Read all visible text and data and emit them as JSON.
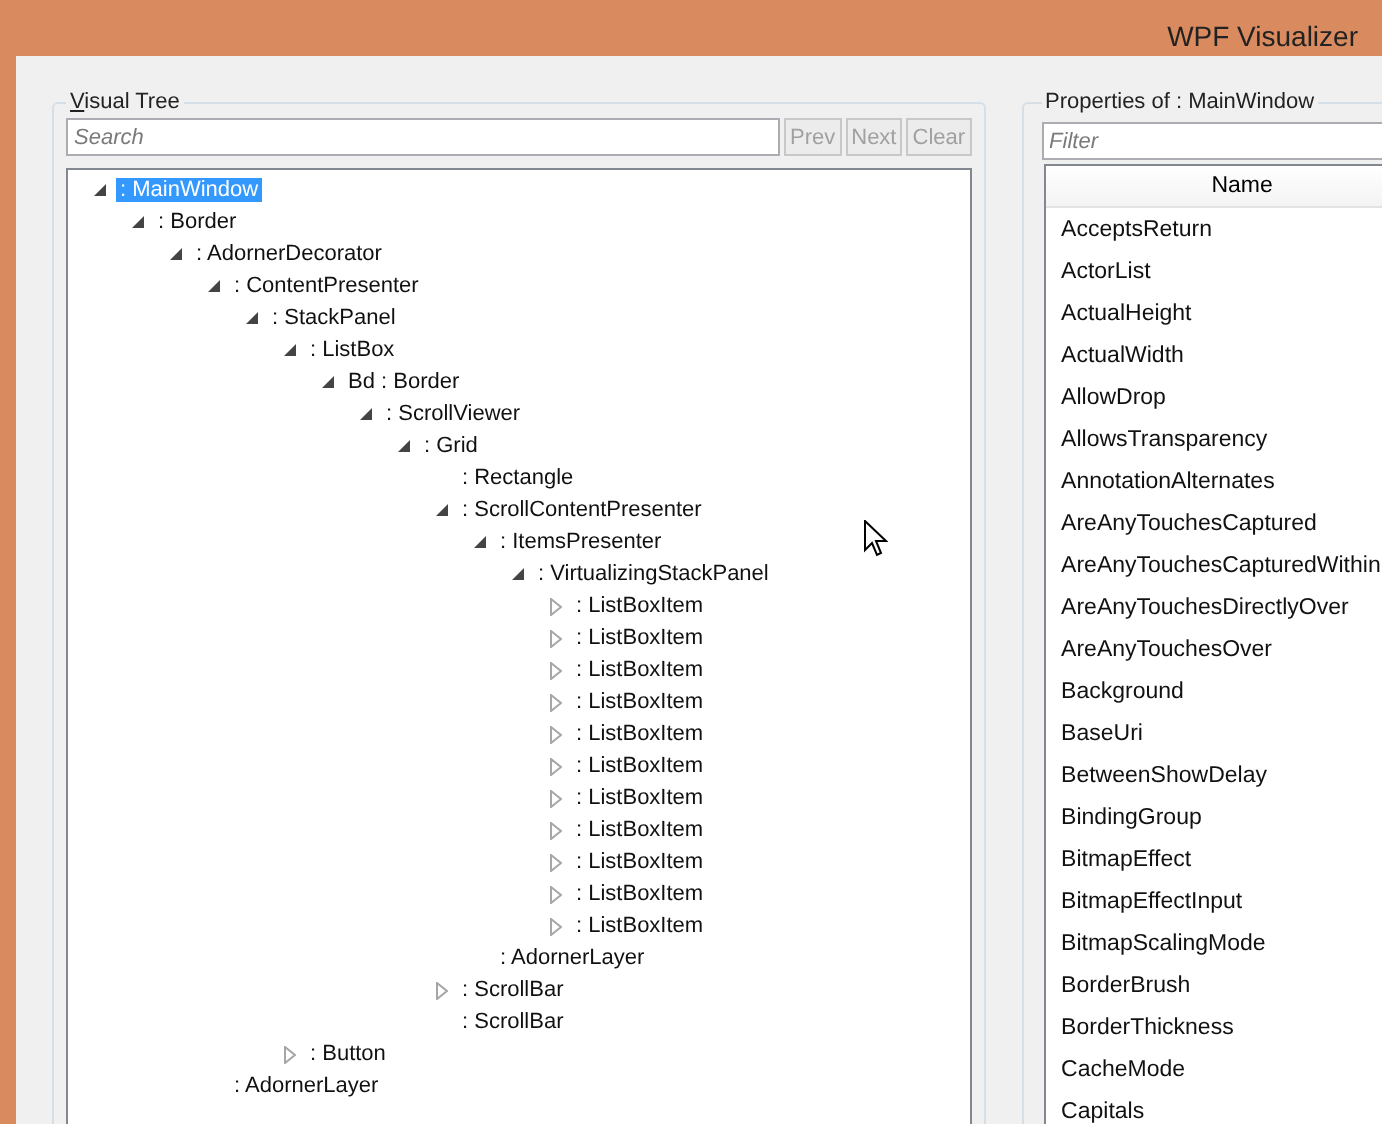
{
  "window": {
    "title": "WPF Visualizer"
  },
  "visual_tree": {
    "title": "Visual Tree",
    "search": {
      "placeholder": "Search"
    },
    "buttons": [
      {
        "label": "Prev",
        "disabled": true
      },
      {
        "label": "Next",
        "disabled": true
      },
      {
        "label": "Clear",
        "disabled": true
      }
    ],
    "nodes": [
      {
        "label": ": MainWindow",
        "expandable": true,
        "expanded": true,
        "selected": true,
        "children": [
          {
            "label": ": Border",
            "expandable": true,
            "expanded": true,
            "selected": false,
            "children": [
              {
                "label": ": AdornerDecorator",
                "expandable": true,
                "expanded": true,
                "selected": false,
                "children": [
                  {
                    "label": ": ContentPresenter",
                    "expandable": true,
                    "expanded": true,
                    "selected": false,
                    "children": [
                      {
                        "label": ": StackPanel",
                        "expandable": true,
                        "expanded": true,
                        "selected": false,
                        "children": [
                          {
                            "label": ": ListBox",
                            "expandable": true,
                            "expanded": true,
                            "selected": false,
                            "children": [
                              {
                                "label": "Bd : Border",
                                "expandable": true,
                                "expanded": true,
                                "selected": false,
                                "children": [
                                  {
                                    "label": ": ScrollViewer",
                                    "expandable": true,
                                    "expanded": true,
                                    "selected": false,
                                    "children": [
                                      {
                                        "label": ": Grid",
                                        "expandable": true,
                                        "expanded": true,
                                        "selected": false,
                                        "children": [
                                          {
                                            "label": ": Rectangle",
                                            "expandable": false,
                                            "selected": false
                                          },
                                          {
                                            "label": ": ScrollContentPresenter",
                                            "expandable": true,
                                            "expanded": true,
                                            "selected": false,
                                            "children": [
                                              {
                                                "label": ": ItemsPresenter",
                                                "expandable": true,
                                                "expanded": true,
                                                "selected": false,
                                                "children": [
                                                  {
                                                    "label": ": VirtualizingStackPanel",
                                                    "expandable": true,
                                                    "expanded": true,
                                                    "selected": false,
                                                    "children": [
                                                      {
                                                        "label": ": ListBoxItem",
                                                        "expandable": true,
                                                        "expanded": false,
                                                        "selected": false
                                                      },
                                                      {
                                                        "label": ": ListBoxItem",
                                                        "expandable": true,
                                                        "expanded": false,
                                                        "selected": false
                                                      },
                                                      {
                                                        "label": ": ListBoxItem",
                                                        "expandable": true,
                                                        "expanded": false,
                                                        "selected": false
                                                      },
                                                      {
                                                        "label": ": ListBoxItem",
                                                        "expandable": true,
                                                        "expanded": false,
                                                        "selected": false
                                                      },
                                                      {
                                                        "label": ": ListBoxItem",
                                                        "expandable": true,
                                                        "expanded": false,
                                                        "selected": false
                                                      },
                                                      {
                                                        "label": ": ListBoxItem",
                                                        "expandable": true,
                                                        "expanded": false,
                                                        "selected": false
                                                      },
                                                      {
                                                        "label": ": ListBoxItem",
                                                        "expandable": true,
                                                        "expanded": false,
                                                        "selected": false
                                                      },
                                                      {
                                                        "label": ": ListBoxItem",
                                                        "expandable": true,
                                                        "expanded": false,
                                                        "selected": false
                                                      },
                                                      {
                                                        "label": ": ListBoxItem",
                                                        "expandable": true,
                                                        "expanded": false,
                                                        "selected": false
                                                      },
                                                      {
                                                        "label": ": ListBoxItem",
                                                        "expandable": true,
                                                        "expanded": false,
                                                        "selected": false
                                                      },
                                                      {
                                                        "label": ": ListBoxItem",
                                                        "expandable": true,
                                                        "expanded": false,
                                                        "selected": false
                                                      }
                                                    ]
                                                  }
                                                ]
                                              },
                                              {
                                                "label": ": AdornerLayer",
                                                "expandable": false,
                                                "selected": false
                                              }
                                            ]
                                          },
                                          {
                                            "label": ": ScrollBar",
                                            "expandable": true,
                                            "expanded": false,
                                            "selected": false
                                          },
                                          {
                                            "label": ": ScrollBar",
                                            "expandable": false,
                                            "selected": false
                                          }
                                        ]
                                      }
                                    ]
                                  }
                                ]
                              }
                            ]
                          },
                          {
                            "label": ": Button",
                            "expandable": true,
                            "expanded": false,
                            "selected": false
                          }
                        ]
                      }
                    ]
                  },
                  {
                    "label": ": AdornerLayer",
                    "expandable": false,
                    "selected": false
                  }
                ]
              }
            ]
          }
        ]
      }
    ]
  },
  "properties": {
    "title": "Properties of  : MainWindow",
    "filter": {
      "placeholder": "Filter"
    },
    "columns": [
      "Name"
    ],
    "rows": [
      "AcceptsReturn",
      "ActorList",
      "ActualHeight",
      "ActualWidth",
      "AllowDrop",
      "AllowsTransparency",
      "AnnotationAlternates",
      "AreAnyTouchesCaptured",
      "AreAnyTouchesCapturedWithin",
      "AreAnyTouchesDirectlyOver",
      "AreAnyTouchesOver",
      "Background",
      "BaseUri",
      "BetweenShowDelay",
      "BindingGroup",
      "BitmapEffect",
      "BitmapEffectInput",
      "BitmapScalingMode",
      "BorderBrush",
      "BorderThickness",
      "CacheMode",
      "Capitals"
    ]
  }
}
